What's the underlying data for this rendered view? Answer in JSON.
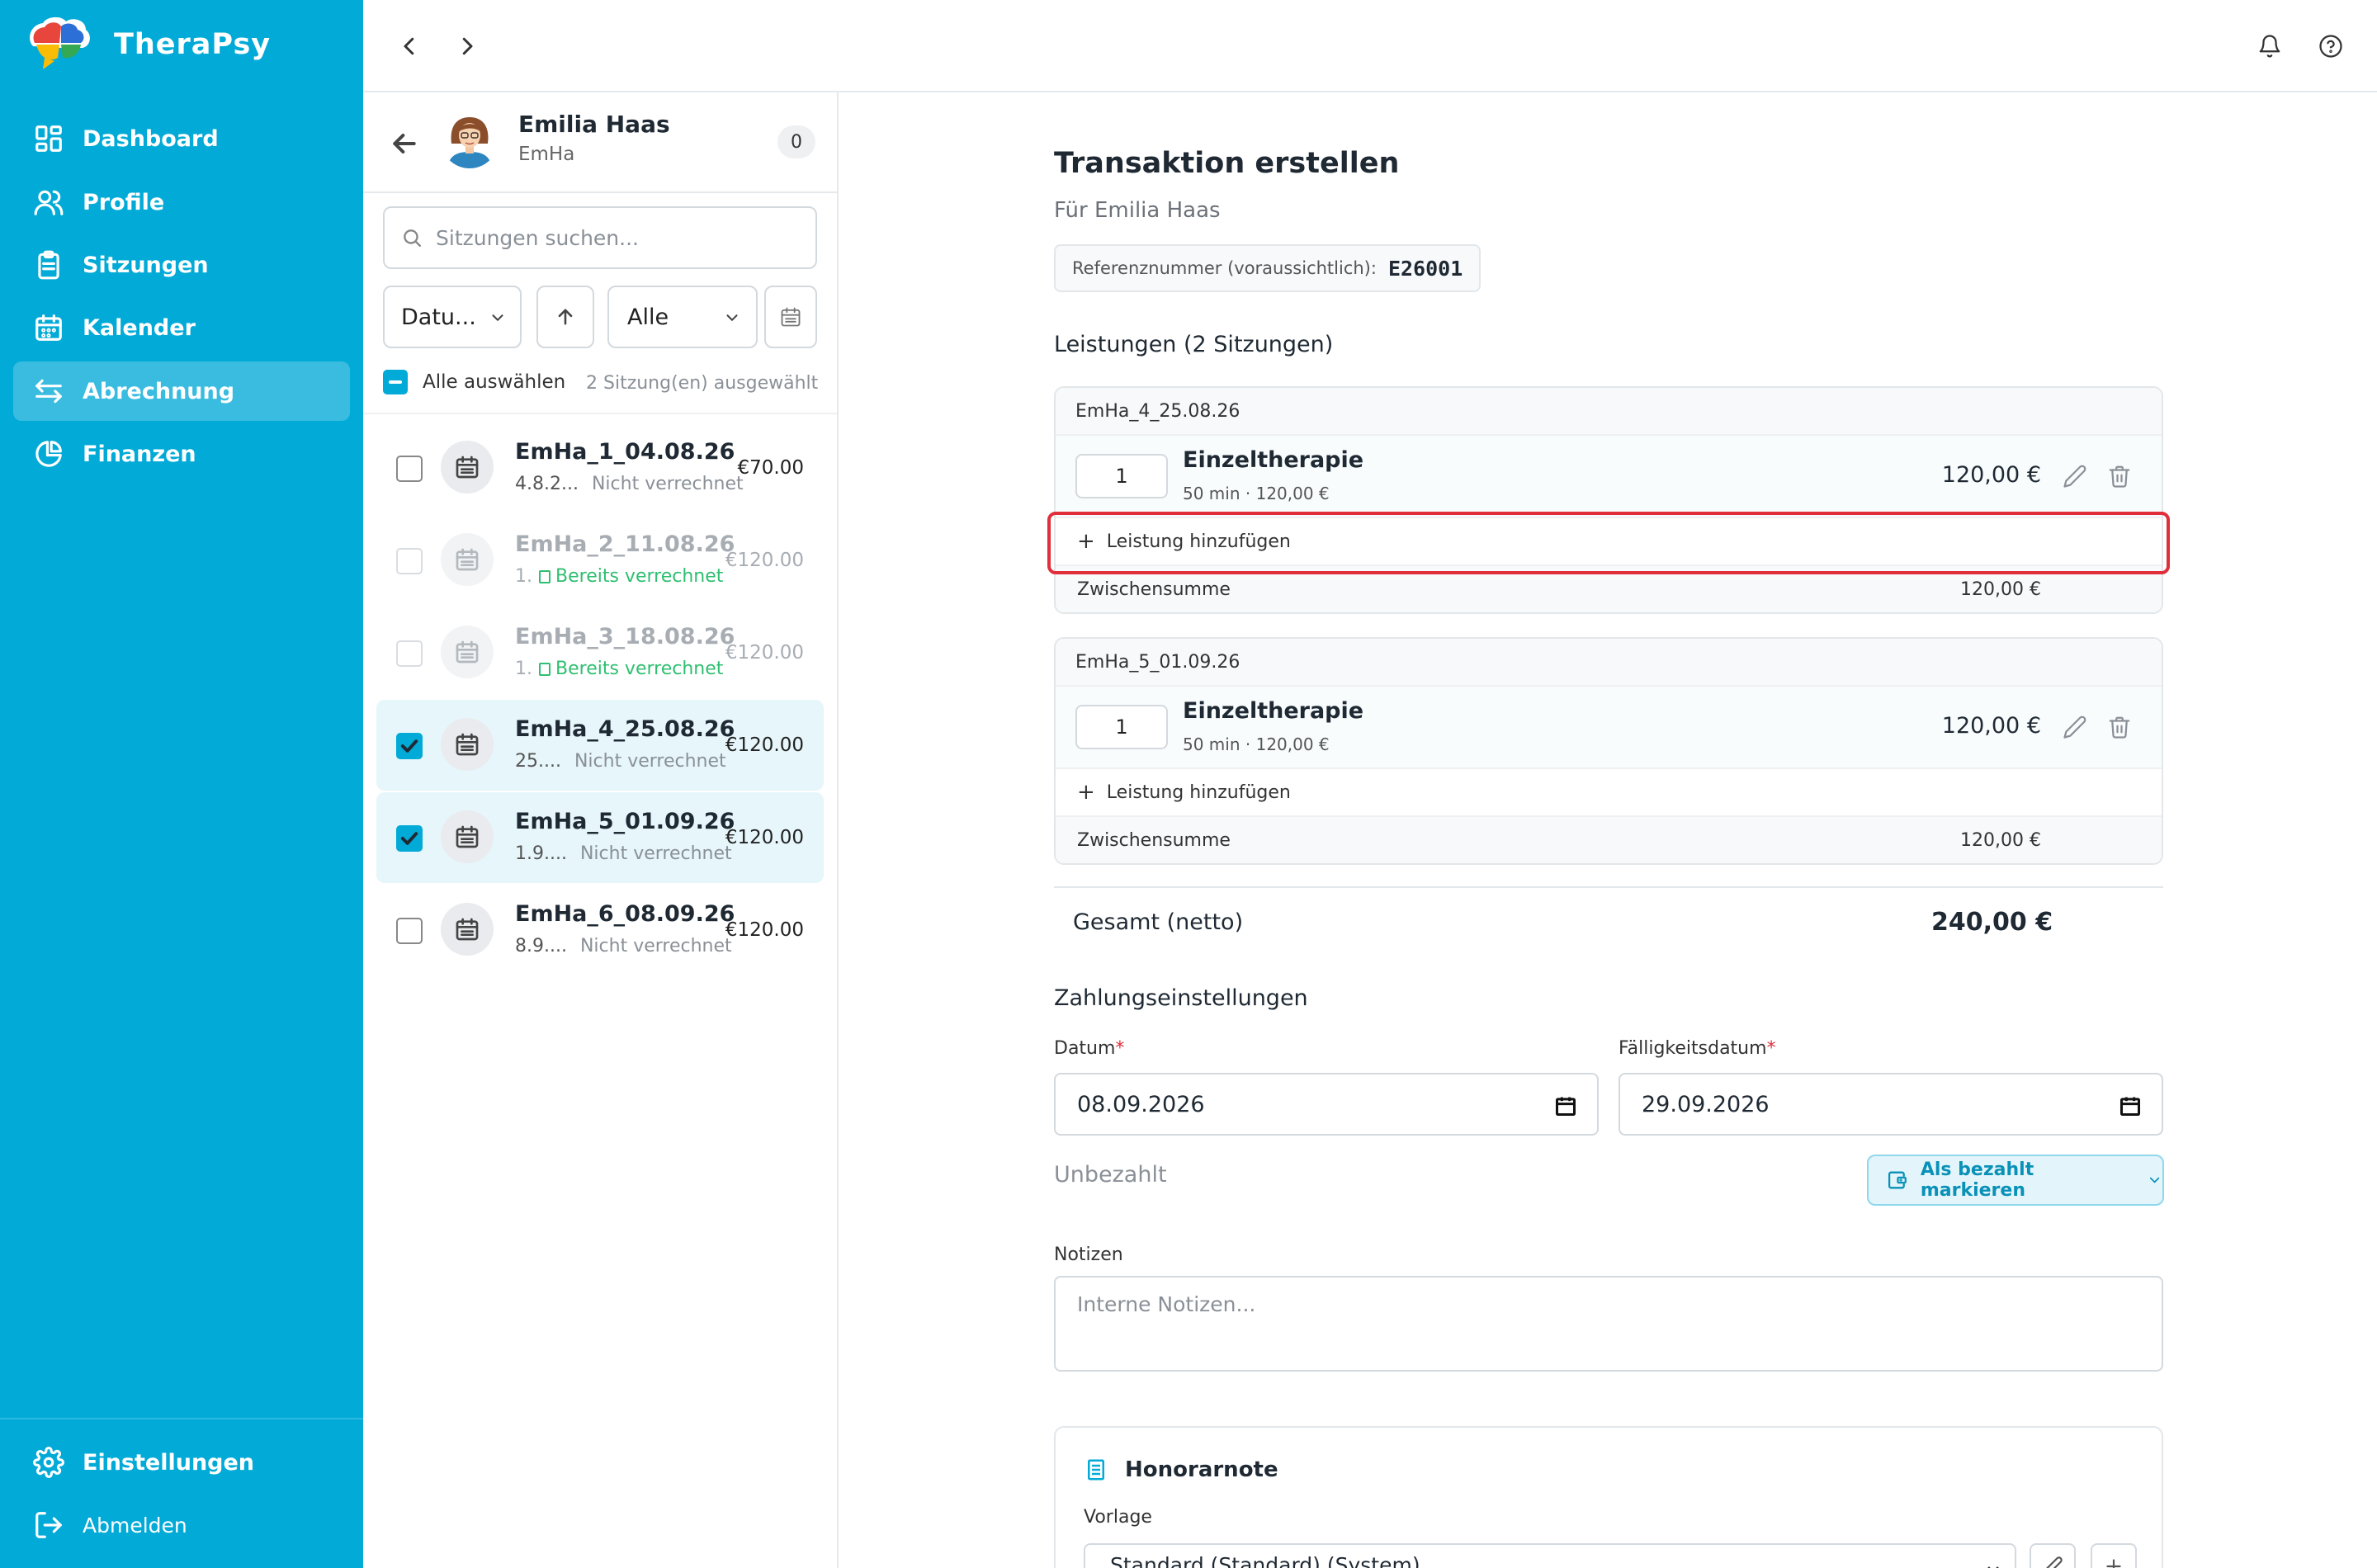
{
  "app": {
    "name": "TheraPsy"
  },
  "sidebar": {
    "items": [
      {
        "label": "Dashboard",
        "icon": "dashboard-icon"
      },
      {
        "label": "Profile",
        "icon": "users-icon"
      },
      {
        "label": "Sitzungen",
        "icon": "clipboard-icon"
      },
      {
        "label": "Kalender",
        "icon": "calendar-icon"
      },
      {
        "label": "Abrechnung",
        "icon": "exchange-arrows-icon",
        "active": true
      },
      {
        "label": "Finanzen",
        "icon": "pie-chart-icon"
      }
    ],
    "settings_label": "Einstellungen",
    "logout_label": "Abmelden"
  },
  "patient": {
    "name": "Emilia Haas",
    "short": "EmHa",
    "count": "0"
  },
  "sessions_panel": {
    "search_placeholder": "Sitzungen suchen...",
    "sort_field": "Datu...",
    "status_filter": "Alle",
    "select_all_label": "Alle auswählen",
    "selected_count": "2 Sitzung(en) ausgewählt",
    "sessions": [
      {
        "title": "EmHa_1_04.08.26",
        "date": "4.8.2...",
        "status": "Nicht verrechnet",
        "price": "€70.00",
        "checked": false,
        "disabled": false
      },
      {
        "title": "EmHa_2_11.08.26",
        "date": "1.",
        "status": "Bereits verrechnet",
        "price": "€120.00",
        "checked": false,
        "disabled": true
      },
      {
        "title": "EmHa_3_18.08.26",
        "date": "1.",
        "status": "Bereits verrechnet",
        "price": "€120.00",
        "checked": false,
        "disabled": true
      },
      {
        "title": "EmHa_4_25.08.26",
        "date": "25....",
        "status": "Nicht verrechnet",
        "price": "€120.00",
        "checked": true,
        "disabled": false
      },
      {
        "title": "EmHa_5_01.09.26",
        "date": "1.9....",
        "status": "Nicht verrechnet",
        "price": "€120.00",
        "checked": true,
        "disabled": false
      },
      {
        "title": "EmHa_6_08.09.26",
        "date": "8.9....",
        "status": "Nicht verrechnet",
        "price": "€120.00",
        "checked": false,
        "disabled": false
      }
    ]
  },
  "transaction": {
    "title": "Transaktion erstellen",
    "for": "Für Emilia Haas",
    "ref_label": "Referenznummer (voraussichtlich):",
    "ref_number": "E26001",
    "services_heading": "Leistungen (2 Sitzungen)",
    "groups": [
      {
        "session": "EmHa_4_25.08.26",
        "qty": "1",
        "service": "Einzeltherapie",
        "meta": "50 min · 120,00 €",
        "price": "120,00 €",
        "add_label": "Leistung hinzufügen",
        "subtotal_label": "Zwischensumme",
        "subtotal": "120,00 €"
      },
      {
        "session": "EmHa_5_01.09.26",
        "qty": "1",
        "service": "Einzeltherapie",
        "meta": "50 min · 120,00 €",
        "price": "120,00 €",
        "add_label": "Leistung hinzufügen",
        "subtotal_label": "Zwischensumme",
        "subtotal": "120,00 €"
      }
    ],
    "total_label": "Gesamt (netto)",
    "total_value": "240,00 €"
  },
  "payment": {
    "heading": "Zahlungseinstellungen",
    "date_label": "Datum",
    "date_value": "08.09.2026",
    "due_label": "Fälligkeitsdatum",
    "due_value": "29.09.2026",
    "status": "Unbezahlt",
    "mark_paid_label": "Als bezahlt markieren",
    "notes_label": "Notizen",
    "notes_placeholder": "Interne Notizen..."
  },
  "invoice": {
    "title": "Honorarnote",
    "template_label": "Vorlage",
    "template_value": "Standard (Standard) (System)"
  },
  "colors": {
    "brand": "#02aad7",
    "highlight": "#e02f3a",
    "billed": "#2fbf71"
  }
}
